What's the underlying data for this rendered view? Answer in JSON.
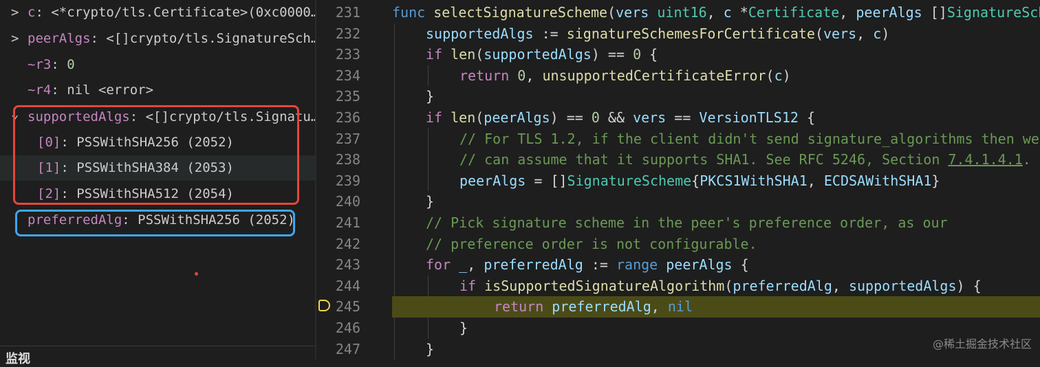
{
  "variables": {
    "rows": [
      {
        "chev": ">",
        "name": "c",
        "sep": ": ",
        "value": "<*crypto/tls.Certificate>(0xc0000",
        "ellipsis": "…"
      },
      {
        "chev": ">",
        "name": "peerAlgs",
        "sep": ": ",
        "value": "<[]crypto/tls.SignatureSch",
        "ellipsis": "…"
      },
      {
        "name": "~r3",
        "sep": ": ",
        "value": "0"
      },
      {
        "name": "~r4",
        "sep": ": ",
        "value": "nil <error>"
      },
      {
        "chev": "⌄",
        "name": "supportedAlgs",
        "sep": ": ",
        "value": "<[]crypto/tls.Signatu",
        "ellipsis": "…"
      },
      {
        "name": "[0]",
        "sep": ": ",
        "value": "PSSWithSHA256 (2052)"
      },
      {
        "name": "[1]",
        "sep": ": ",
        "value": "PSSWithSHA384 (2053)"
      },
      {
        "name": "[2]",
        "sep": ": ",
        "value": "PSSWithSHA512 (2054)"
      },
      {
        "name": "preferredAlg",
        "sep": ": ",
        "value": "PSSWithSHA256 (2052)"
      }
    ],
    "watch_label": "监视"
  },
  "editor": {
    "lines": [
      {
        "n": "231",
        "parts": [
          [
            "kw",
            "func "
          ],
          [
            "fn",
            "selectSignatureScheme"
          ],
          [
            "pl",
            "("
          ],
          [
            "va",
            "vers"
          ],
          [
            "pl",
            " "
          ],
          [
            "ty",
            "uint16"
          ],
          [
            "pl",
            ", "
          ],
          [
            "va",
            "c"
          ],
          [
            "pl",
            " *"
          ],
          [
            "ty",
            "Certificate"
          ],
          [
            "pl",
            ", "
          ],
          [
            "va",
            "peerAlgs"
          ],
          [
            "pl",
            " []"
          ],
          [
            "ty",
            "SignatureSche"
          ]
        ]
      },
      {
        "n": "232",
        "parts": [
          [
            "va",
            "supportedAlgs"
          ],
          [
            "pl",
            " := "
          ],
          [
            "fn",
            "signatureSchemesForCertificate"
          ],
          [
            "pl",
            "("
          ],
          [
            "va",
            "vers"
          ],
          [
            "pl",
            ", "
          ],
          [
            "va",
            "c"
          ],
          [
            "pl",
            ")"
          ]
        ]
      },
      {
        "n": "233",
        "parts": [
          [
            "kc",
            "if "
          ],
          [
            "fn",
            "len"
          ],
          [
            "pl",
            "("
          ],
          [
            "va",
            "supportedAlgs"
          ],
          [
            "pl",
            ") == "
          ],
          [
            "nm",
            "0"
          ],
          [
            "pl",
            " {"
          ]
        ]
      },
      {
        "n": "234",
        "parts": [
          [
            "kc",
            "return "
          ],
          [
            "nm",
            "0"
          ],
          [
            "pl",
            ", "
          ],
          [
            "fn",
            "unsupportedCertificateError"
          ],
          [
            "pl",
            "("
          ],
          [
            "va",
            "c"
          ],
          [
            "pl",
            ")"
          ]
        ]
      },
      {
        "n": "235",
        "parts": [
          [
            "pl",
            "}"
          ]
        ]
      },
      {
        "n": "236",
        "parts": [
          [
            "kc",
            "if "
          ],
          [
            "fn",
            "len"
          ],
          [
            "pl",
            "("
          ],
          [
            "va",
            "peerAlgs"
          ],
          [
            "pl",
            ") == "
          ],
          [
            "nm",
            "0"
          ],
          [
            "pl",
            " && "
          ],
          [
            "va",
            "vers"
          ],
          [
            "pl",
            " == "
          ],
          [
            "va",
            "VersionTLS12"
          ],
          [
            "pl",
            " {"
          ]
        ]
      },
      {
        "n": "237",
        "parts": [
          [
            "cm",
            "// For TLS 1.2, if the client didn't send signature_algorithms then we"
          ]
        ]
      },
      {
        "n": "238",
        "parts": [
          [
            "cm",
            "// can assume that it supports SHA1. See RFC 5246, Section "
          ],
          [
            "cu",
            "7.4.1.4.1"
          ],
          [
            "cm",
            "."
          ]
        ]
      },
      {
        "n": "239",
        "parts": [
          [
            "va",
            "peerAlgs"
          ],
          [
            "pl",
            " = []"
          ],
          [
            "ty",
            "SignatureScheme"
          ],
          [
            "pl",
            "{"
          ],
          [
            "va",
            "PKCS1WithSHA1"
          ],
          [
            "pl",
            ", "
          ],
          [
            "va",
            "ECDSAWithSHA1"
          ],
          [
            "pl",
            "}"
          ]
        ]
      },
      {
        "n": "240",
        "parts": [
          [
            "pl",
            "}"
          ]
        ]
      },
      {
        "n": "241",
        "parts": [
          [
            "cm",
            "// Pick signature scheme in the peer's preference order, as our"
          ]
        ]
      },
      {
        "n": "242",
        "parts": [
          [
            "cm",
            "// preference order is not configurable."
          ]
        ]
      },
      {
        "n": "243",
        "parts": [
          [
            "kc",
            "for "
          ],
          [
            "va",
            "_"
          ],
          [
            "pl",
            ", "
          ],
          [
            "va",
            "preferredAlg"
          ],
          [
            "pl",
            " := "
          ],
          [
            "kw",
            "range "
          ],
          [
            "va",
            "peerAlgs"
          ],
          [
            "pl",
            " {"
          ]
        ]
      },
      {
        "n": "244",
        "parts": [
          [
            "kc",
            "if "
          ],
          [
            "fn",
            "isSupportedSignatureAlgorithm"
          ],
          [
            "pl",
            "("
          ],
          [
            "va",
            "preferredAlg"
          ],
          [
            "pl",
            ", "
          ],
          [
            "va",
            "supportedAlgs"
          ],
          [
            "pl",
            ") {"
          ]
        ]
      },
      {
        "n": "245",
        "parts": [
          [
            "kc",
            "return "
          ],
          [
            "va",
            "preferredAlg"
          ],
          [
            "pl",
            ", "
          ],
          [
            "kw",
            "nil"
          ]
        ]
      },
      {
        "n": "246",
        "parts": [
          [
            "pl",
            "}"
          ]
        ]
      },
      {
        "n": "247",
        "parts": [
          [
            "pl",
            "}"
          ]
        ]
      }
    ],
    "current_line": "245"
  },
  "watermark": "@稀土掘金技术社区",
  "colors": {
    "red_box": "#e5473a",
    "blue_box": "#3fa7ee",
    "current_line_bg": "#4b4b18",
    "breakpoint_marker": "#f5d442"
  }
}
